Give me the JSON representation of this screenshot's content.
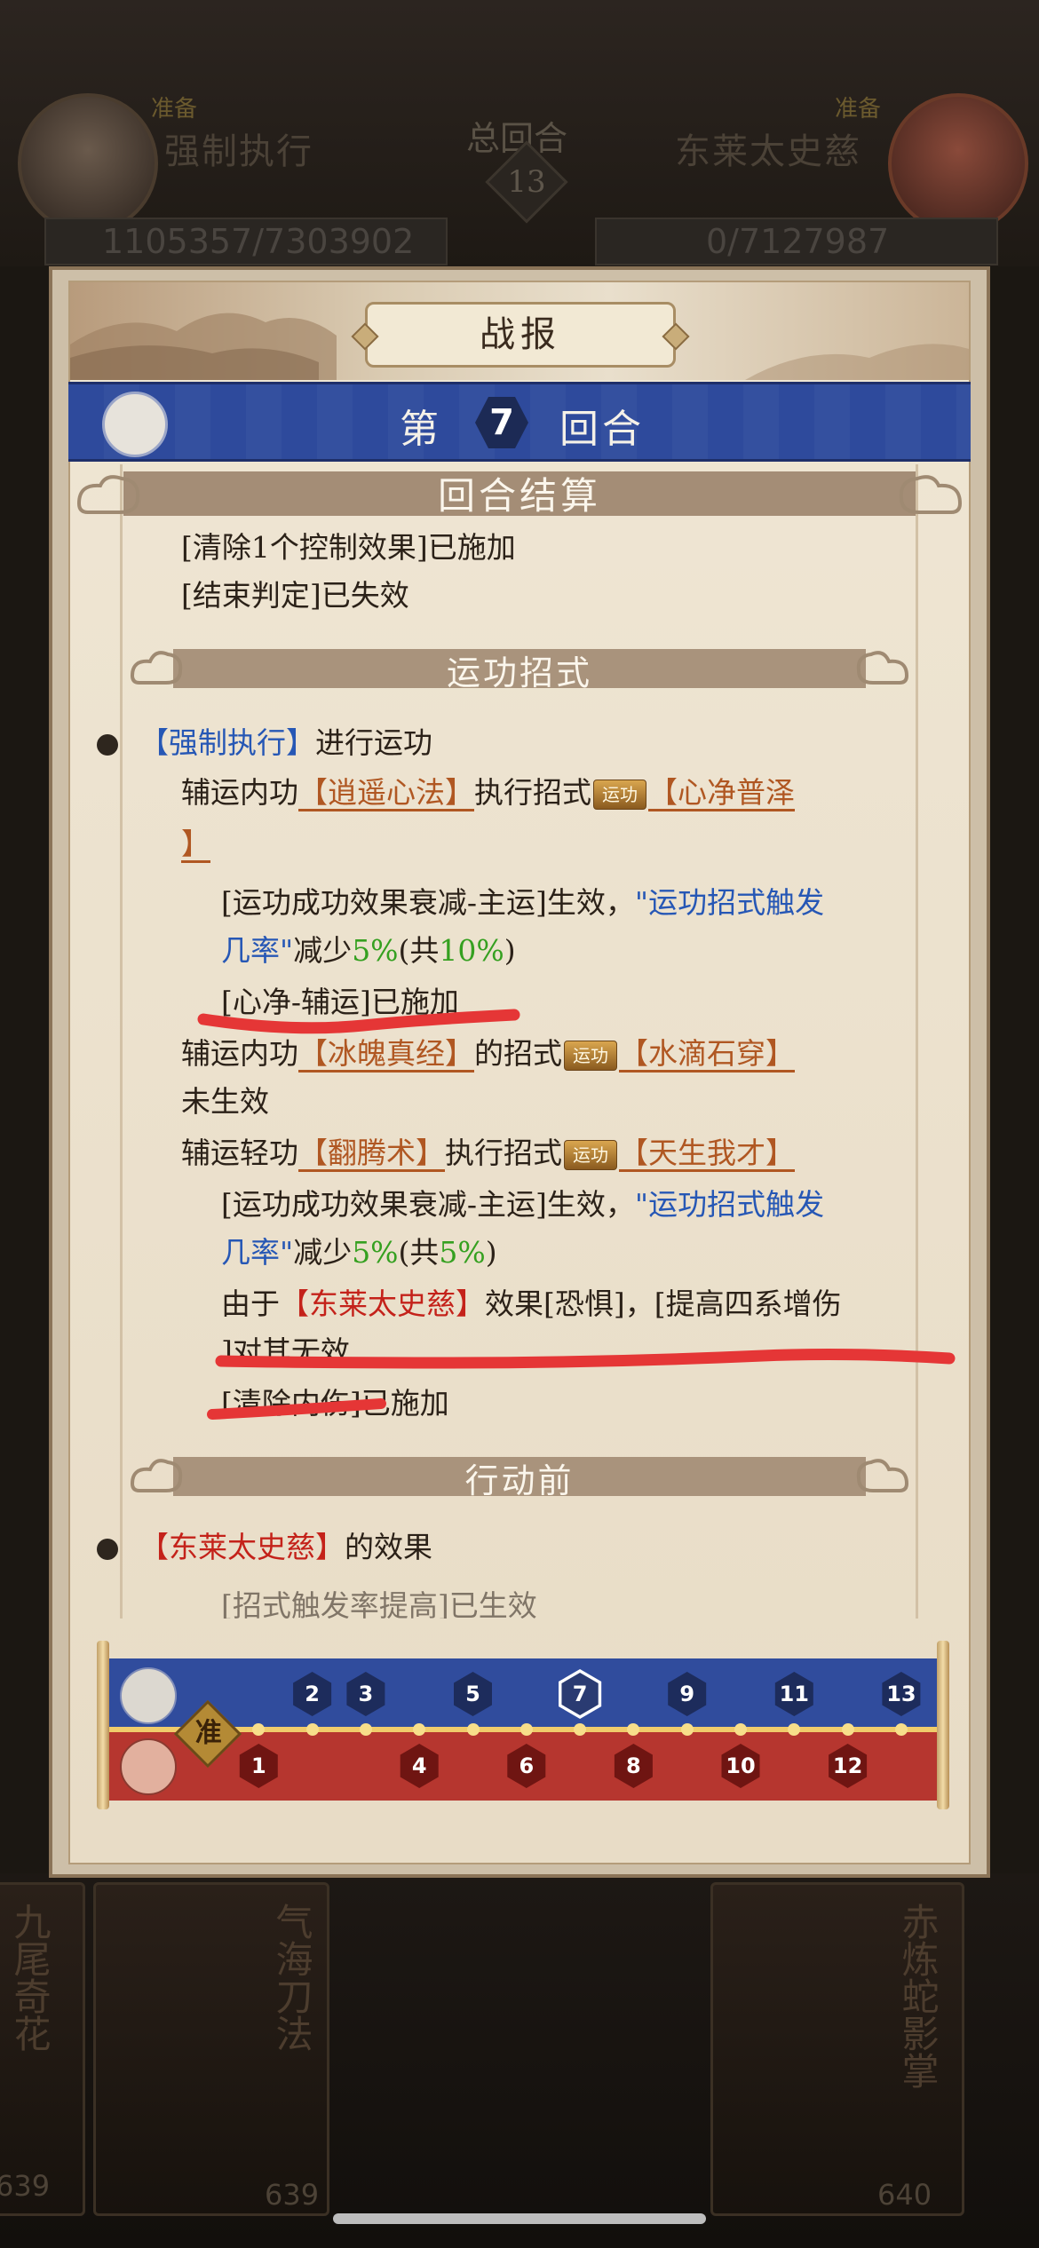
{
  "background": {
    "left_player": {
      "status": "准备",
      "name": "强制执行",
      "hp": "1105357/7303902"
    },
    "right_player": {
      "status": "准备",
      "name": "东莱太史慈",
      "hp": "0/7127987"
    },
    "round_label": "总回合",
    "round_number": "13",
    "cards": [
      {
        "title": "九尾奇花",
        "number": "639"
      },
      {
        "title": "气海刀法",
        "number": "639"
      },
      {
        "title": "赤炼蛇影掌",
        "number": "640"
      }
    ]
  },
  "dialog": {
    "title": "战报",
    "round_prefix": "第",
    "round_number": "7",
    "round_suffix": "回合"
  },
  "sections": {
    "settlement": "回合结算",
    "skills": "运功招式",
    "before_action": "行动前"
  },
  "log": {
    "l1": "[清除1个控制效果]已施加",
    "l2": "[结束判定]已失效",
    "l3_name": "【强制执行】",
    "l3_rest": "进行运功",
    "l4_a": "辅运内功",
    "l4_skill": "【逍遥心法】",
    "l4_b": "执行招式",
    "tag_label": "运功",
    "l4_move": "【心净普泽",
    "l5": "】",
    "l6_a": "[运功成功效果衰减-主运]生效，",
    "l6_q": "\"运功招式触发",
    "l7_a": "几率\"",
    "l7_b": "减少",
    "l7_pct": "5%",
    "l7_c": "(共",
    "l7_total": "10%",
    "l7_d": ")",
    "l8": "[心净-辅运]已施加",
    "l9_a": "辅运内功",
    "l9_skill": "【冰魄真经】",
    "l9_b": "的招式",
    "l9_move": "【水滴石穿】",
    "l10": "未生效",
    "l11_a": "辅运轻功",
    "l11_skill": "【翻腾术】",
    "l11_b": "执行招式",
    "l11_move": "【天生我才】",
    "l12_a": "[运功成功效果衰减-主运]生效，",
    "l12_q": "\"运功招式触发",
    "l13_a": "几率\"",
    "l13_b": "减少",
    "l13_pct": "5%",
    "l13_c": "(共",
    "l13_total": "5%",
    "l13_d": ")",
    "l14_a": "由于",
    "l14_name": "【东莱太史慈】",
    "l14_b": "效果[恐惧]，[提高四系增伤",
    "l15": "]对其无效",
    "l16": "[清除内伤]已施加",
    "l17_name": "【东莱太史慈】",
    "l17_rest": "的效果",
    "l18": "[招式触发率提高]已生效"
  },
  "timeline": {
    "ready_label": "准",
    "current_round": "7",
    "blue_rounds": [
      "2",
      "3",
      "5",
      "7",
      "9",
      "11",
      "13"
    ],
    "red_rounds": [
      "1",
      "4",
      "6",
      "8",
      "10",
      "12"
    ]
  },
  "colors": {
    "red_text": "#c4221a",
    "orange_text": "#b05722",
    "blue_text": "#2657b5",
    "green_text": "#35a020",
    "blue_band": "#304c9d",
    "red_band": "#b6362f",
    "annotation": "#e53636"
  }
}
